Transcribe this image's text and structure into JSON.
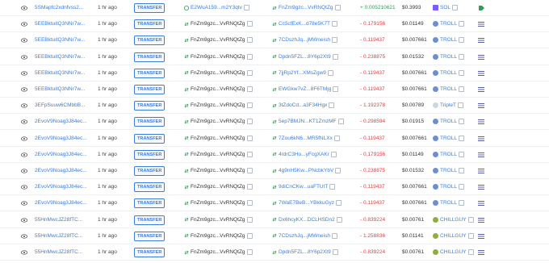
{
  "colors": {
    "link": "#3b7ddd",
    "negative": "#d64545",
    "positive": "#2e9f57",
    "transfer_badge": "#3b7ddd"
  },
  "rows": [
    {
      "signature": "5SMapfc2xdnfvss2...",
      "age": "1 hr ago",
      "type": "TRANSFER",
      "from": "E2WuA159...m2Y3qtv",
      "to": "FnZm9gzc...VvRNQtZg",
      "amount": "+ 0.005210621",
      "value": "$0.3993",
      "token": "SOL",
      "token_icon": "sol-icon",
      "from_icon": "circle-user-icon",
      "flag": "green-tag-icon"
    },
    {
      "signature": "5EEBktuitQ3NNr7w...",
      "age": "1 hr ago",
      "type": "TRANSFER",
      "from": "FnZm9gzc...VvRNQtZg",
      "to": "Cc5cfExK...d78e5K7T",
      "amount": "- 0.179156",
      "value": "$0.01149",
      "token": "TROLL",
      "token_icon": "troll-icon",
      "from_icon": "swap-icon",
      "flag": "list-icon"
    },
    {
      "signature": "5EEBktuitQ3NNr7w...",
      "age": "1 hr ago",
      "type": "TRANSFER",
      "from": "FnZm9gzc...VvRNQtZg",
      "to": "7CDszhJq...jMWneish",
      "amount": "- 0.119437",
      "value": "$0.007661",
      "token": "TROLL",
      "token_icon": "troll-icon",
      "from_icon": "swap-icon",
      "flag": "list-icon"
    },
    {
      "signature": "5EEBktuitQ3NNr7w...",
      "age": "1 hr ago",
      "type": "TRANSFER",
      "from": "FnZm9gzc...VvRNQtZg",
      "to": "Dpdn5FZL...8Y6p2Xt9",
      "amount": "- 0.238875",
      "value": "$0.01532",
      "token": "TROLL",
      "token_icon": "troll-icon",
      "from_icon": "swap-icon",
      "flag": "list-icon"
    },
    {
      "signature": "5EEBktuitQ3NNr7w...",
      "age": "1 hr ago",
      "type": "TRANSFER",
      "from": "FnZm9gzc...VvRNQtZg",
      "to": "7jjRp2Yf...XMsZgw9",
      "amount": "- 0.119437",
      "value": "$0.007661",
      "token": "TROLL",
      "token_icon": "troll-icon",
      "from_icon": "swap-icon",
      "flag": "list-icon"
    },
    {
      "signature": "5EEBktuitQ3NNr7w...",
      "age": "1 hr ago",
      "type": "TRANSFER",
      "from": "FnZm9gzc...VvRNQtZg",
      "to": "EWGkw7vZ...8F6TMjg",
      "amount": "- 0.119437",
      "value": "$0.007661",
      "token": "TROLL",
      "token_icon": "troll-icon",
      "from_icon": "swap-icon",
      "flag": "list-icon"
    },
    {
      "signature": "3EFpSuuw6CMbbB...",
      "age": "1 hr ago",
      "type": "TRANSFER",
      "from": "FnZm9gzc...VvRNQtZg",
      "to": "3tZdoCd...a3F34Hgx",
      "amount": "- 1.192378",
      "value": "$0.00789",
      "token": "TripleT",
      "token_icon": "triplet-icon",
      "from_icon": "swap-icon",
      "flag": "list-icon"
    },
    {
      "signature": "2EvoV9Noag3J84ec...",
      "age": "1 hr ago",
      "type": "TRANSFER",
      "from": "FnZm9gzc...VvRNQtZg",
      "to": "5ep7BMJN...KT1ZmzMF",
      "amount": "- 0.298594",
      "value": "$0.01915",
      "token": "TROLL",
      "token_icon": "troll-icon",
      "from_icon": "swap-icon",
      "flag": "list-icon"
    },
    {
      "signature": "2EvoV9Noag3J84ec...",
      "age": "1 hr ago",
      "type": "TRANSFER",
      "from": "FnZm9gzc...VvRNQtZg",
      "to": "7Zou6kN6...MR5fNLXx",
      "amount": "- 0.119437",
      "value": "$0.007661",
      "token": "TROLL",
      "token_icon": "troll-icon",
      "from_icon": "swap-icon",
      "flag": "list-icon"
    },
    {
      "signature": "2EvoV9Noag3J84ec...",
      "age": "1 hr ago",
      "type": "TRANSFER",
      "from": "FnZm9gzc...VvRNQtZg",
      "to": "4rdrC3Ho...yFcgXAKr",
      "amount": "- 0.179156",
      "value": "$0.01149",
      "token": "TROLL",
      "token_icon": "troll-icon",
      "from_icon": "swap-icon",
      "flag": "list-icon"
    },
    {
      "signature": "2EvoV9Noag3J84ec...",
      "age": "1 hr ago",
      "type": "TRANSFER",
      "from": "FnZm9gzc...VvRNQtZg",
      "to": "4g9nH5Kw...PNcbkYbV",
      "amount": "- 0.238875",
      "value": "$0.01532",
      "token": "TROLL",
      "token_icon": "troll-icon",
      "from_icon": "swap-icon",
      "flag": "list-icon"
    },
    {
      "signature": "2EvoV9Noag3J84ec...",
      "age": "1 hr ago",
      "type": "TRANSFER",
      "from": "FnZm9gzc...VvRNQtZg",
      "to": "9diCnCKw...uaFTUtT",
      "amount": "- 0.119437",
      "value": "$0.007661",
      "token": "TROLL",
      "token_icon": "troll-icon",
      "from_icon": "swap-icon",
      "flag": "list-icon"
    },
    {
      "signature": "2EvoV9Noag3J84ec...",
      "age": "1 hr ago",
      "type": "TRANSFER",
      "from": "FnZm9gzc...VvRNQtZg",
      "to": "7WaE7BeB...YBkkuGyz",
      "amount": "- 0.119437",
      "value": "$0.007661",
      "token": "TROLL",
      "token_icon": "troll-icon",
      "from_icon": "swap-icon",
      "flag": "list-icon"
    },
    {
      "signature": "55HnMwcJZ28fTC...",
      "age": "1 hr ago",
      "type": "TRANSFER",
      "from": "FnZm9gzc...VvRNQtZg",
      "to": "Dx6hcyKX...DCLHSDn2",
      "amount": "- 0.839224",
      "value": "$0.00761",
      "token": "CHILLGUY",
      "token_icon": "chillguy-icon",
      "from_icon": "swap-icon",
      "flag": "list-icon"
    },
    {
      "signature": "55HnMwcJZ28fTC...",
      "age": "1 hr ago",
      "type": "TRANSFER",
      "from": "FnZm9gzc...VvRNQtZg",
      "to": "7CDszhJq...jMWneish",
      "amount": "- 1.258836",
      "value": "$0.01141",
      "token": "CHILLGUY",
      "token_icon": "chillguy-icon",
      "from_icon": "swap-icon",
      "flag": "list-icon"
    },
    {
      "signature": "55HnMwcJZ28fTC...",
      "age": "1 hr ago",
      "type": "TRANSFER",
      "from": "FnZm9gzc...VvRNQtZg",
      "to": "Dpdn5FZL...8Y6p2Xt9",
      "amount": "- 0.839224",
      "value": "$0.00761",
      "token": "CHILLGUY",
      "token_icon": "chillguy-icon",
      "from_icon": "swap-icon",
      "flag": "list-icon"
    }
  ]
}
